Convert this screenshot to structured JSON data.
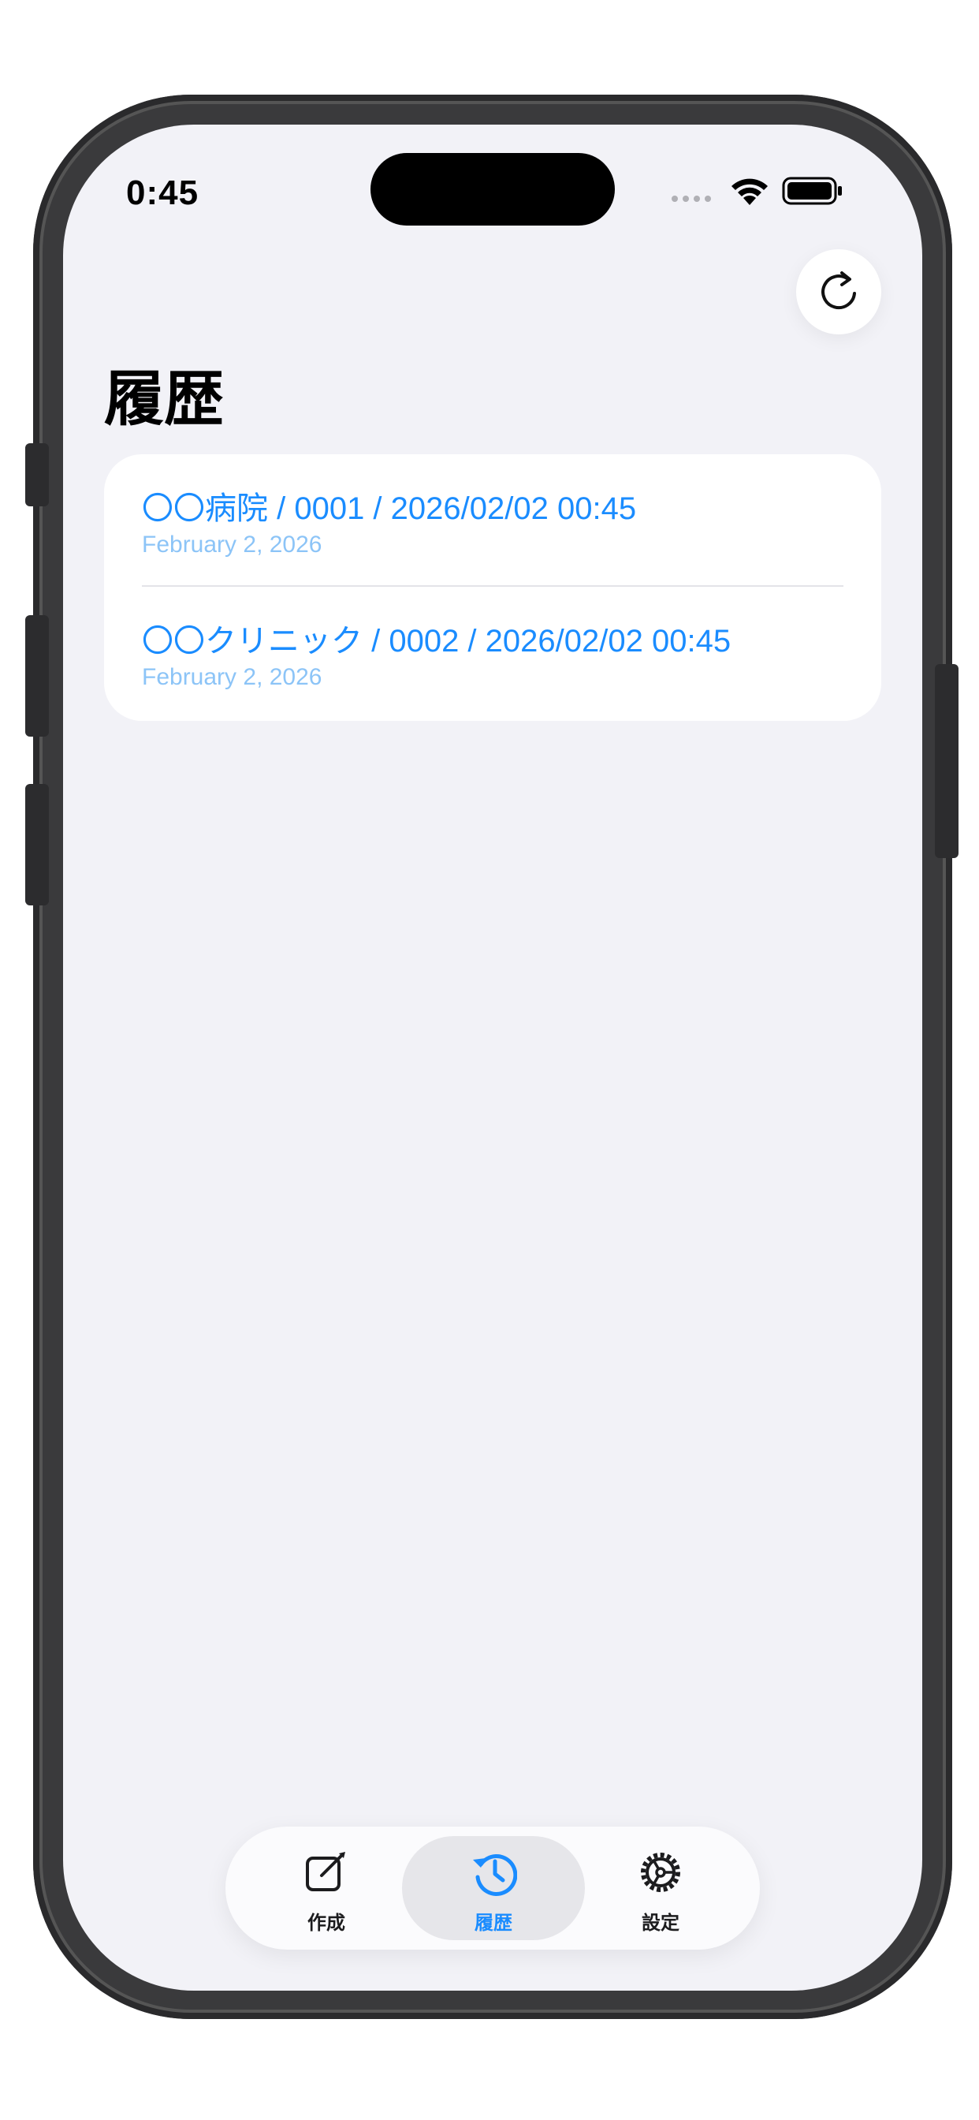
{
  "status_bar": {
    "time": "0:45"
  },
  "page": {
    "title": "履歴"
  },
  "history": {
    "items": [
      {
        "title": "〇〇病院 / 0001 / 2026/02/02 00:45",
        "date": "February 2, 2026"
      },
      {
        "title": "〇〇クリニック / 0002 / 2026/02/02 00:45",
        "date": "February 2, 2026"
      }
    ]
  },
  "tab_bar": {
    "tabs": [
      {
        "label": "作成",
        "icon": "compose-icon",
        "active": false
      },
      {
        "label": "履歴",
        "icon": "history-icon",
        "active": true
      },
      {
        "label": "設定",
        "icon": "settings-gear-icon",
        "active": false
      }
    ]
  },
  "colors": {
    "accent": "#1a8cff",
    "subtitle": "#8cc4f7",
    "background": "#f2f2f7",
    "card": "#ffffff"
  },
  "toolbar": {
    "refresh_icon": "refresh-icon"
  }
}
